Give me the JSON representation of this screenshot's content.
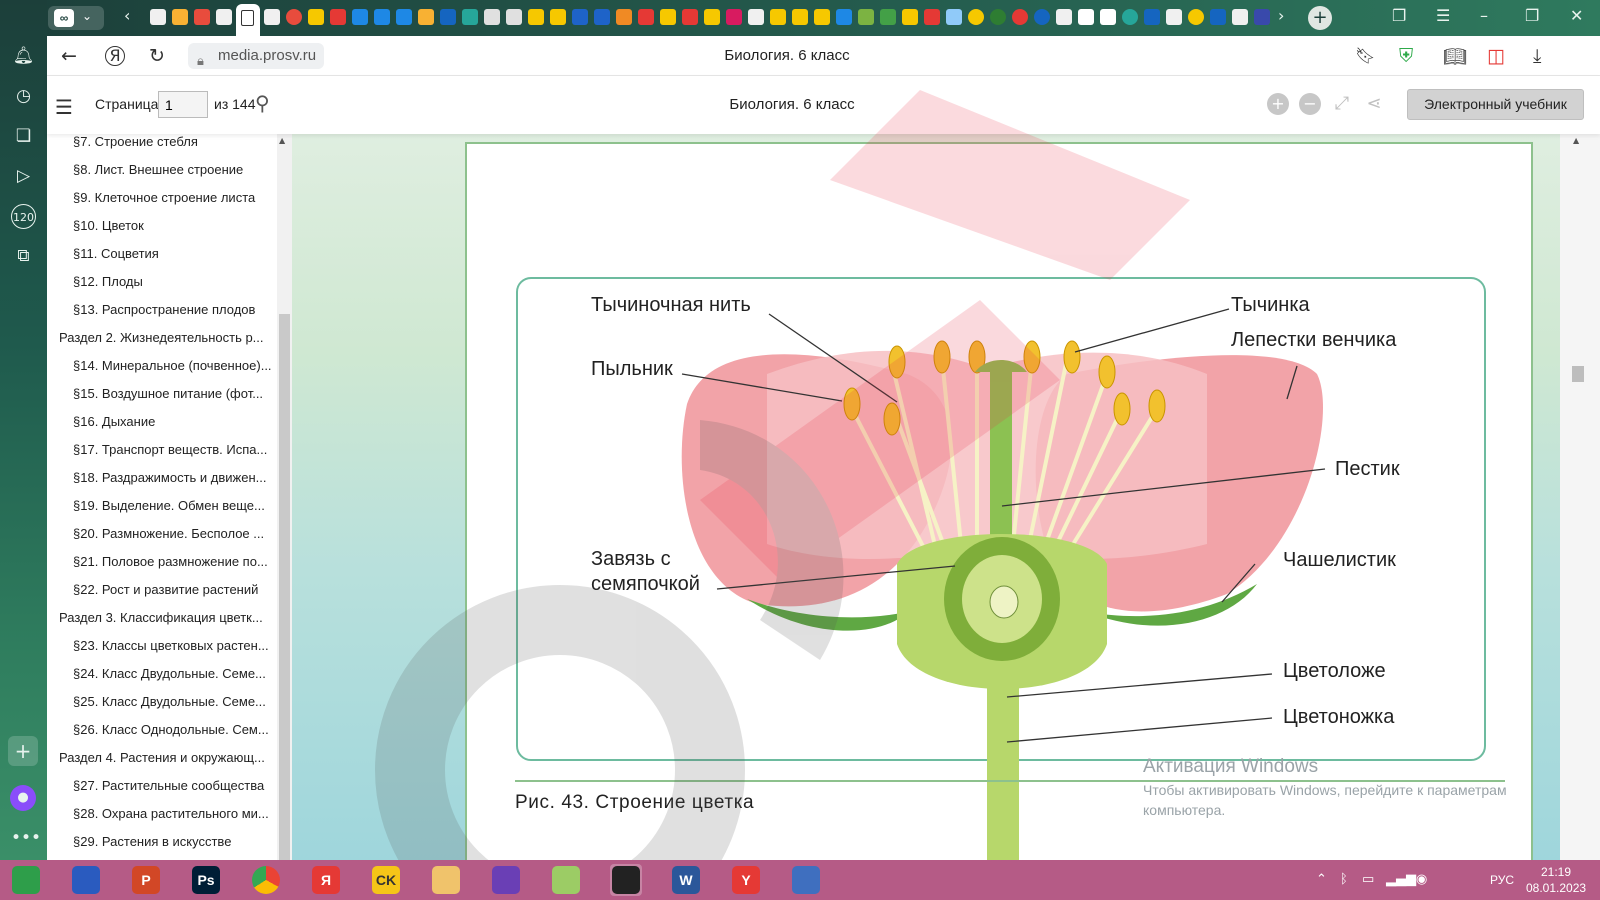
{
  "browser": {
    "active_tab_title": "Биология. 6 класс",
    "url": "media.prosv.ru",
    "tab_controls": {
      "back": "‹",
      "forward": "›",
      "new_tab": "+"
    },
    "window_controls": [
      "tabs-icon",
      "menu-icon",
      "minimize-icon",
      "restore-icon",
      "close-icon"
    ],
    "accent_color": "#1f5a4d"
  },
  "reader": {
    "page_label": "Страница",
    "page_value": "1",
    "page_total": "из 144",
    "title": "Биология. 6 класс",
    "ebook_button": "Электронный учебник"
  },
  "toc": {
    "items": [
      {
        "label": "§7. Строение стебля",
        "level": 2
      },
      {
        "label": "§8. Лист. Внешнее строение",
        "level": 2
      },
      {
        "label": "§9. Клеточное строение листа",
        "level": 2
      },
      {
        "label": "§10. Цветок",
        "level": 2
      },
      {
        "label": "§11. Соцветия",
        "level": 2
      },
      {
        "label": "§12. Плоды",
        "level": 2
      },
      {
        "label": "§13. Распространение плодов",
        "level": 2
      },
      {
        "label": "Раздел 2. Жизнедеятельность р...",
        "level": 1
      },
      {
        "label": "§14. Минеральное (почвенное)...",
        "level": 2
      },
      {
        "label": "§15. Воздушное питание (фот...",
        "level": 2
      },
      {
        "label": "§16. Дыхание",
        "level": 2
      },
      {
        "label": "§17. Транспорт веществ. Испа...",
        "level": 2
      },
      {
        "label": "§18. Раздражимость и движен...",
        "level": 2
      },
      {
        "label": "§19. Выделение. Обмен веще...",
        "level": 2
      },
      {
        "label": "§20. Размножение. Бесполое ...",
        "level": 2
      },
      {
        "label": "§21. Половое размножение по...",
        "level": 2
      },
      {
        "label": "§22. Рост и развитие растений",
        "level": 2
      },
      {
        "label": "Раздел 3. Классификация цветк...",
        "level": 1
      },
      {
        "label": "§23. Классы цветковых растен...",
        "level": 2
      },
      {
        "label": "§24. Класс Двудольные. Семе...",
        "level": 2
      },
      {
        "label": "§25. Класс Двудольные. Семе...",
        "level": 2
      },
      {
        "label": "§26. Класс Однодольные. Сем...",
        "level": 2
      },
      {
        "label": "Раздел 4. Растения и окружающ...",
        "level": 1
      },
      {
        "label": "§27. Растительные сообщества",
        "level": 2
      },
      {
        "label": "§28. Охрана растительного ми...",
        "level": 2
      },
      {
        "label": "§29. Растения в искусстве",
        "level": 2
      }
    ]
  },
  "figure": {
    "labels": {
      "filament": "Тычиночная нить",
      "anther": "Пыльник",
      "stamen": "Тычинка",
      "petals": "Лепестки венчика",
      "pistil": "Пестик",
      "ovary_line1": "Завязь с",
      "ovary_line2": "семяпочкой",
      "sepal": "Чашелистик",
      "receptacle": "Цветоложе",
      "pedicel": "Цветоножка"
    },
    "caption": "Рис. 43. Строение цветка",
    "colors": {
      "petal": "#f2a3a8",
      "stem": "#9ccc65",
      "anther": "#f2c12e",
      "frame": "#6dbb9f"
    }
  },
  "windows_activation": {
    "title": "Активация Windows",
    "text": "Чтобы активировать Windows, перейдите к параметрам компьютера."
  },
  "taskbar": {
    "apps": [
      {
        "name": "clover-app",
        "label": ""
      },
      {
        "name": "archive-app",
        "label": ""
      },
      {
        "name": "powerpoint-app",
        "label": "P"
      },
      {
        "name": "photoshop-app",
        "label": "Ps"
      },
      {
        "name": "chrome-app",
        "label": ""
      },
      {
        "name": "yandex-browser-app",
        "label": "Я"
      },
      {
        "name": "ck-app",
        "label": "CK"
      },
      {
        "name": "explorer-app",
        "label": ""
      },
      {
        "name": "visual-studio-app",
        "label": ""
      },
      {
        "name": "paint-app",
        "label": ""
      },
      {
        "name": "inkscape-app",
        "label": ""
      },
      {
        "name": "word-app",
        "label": "W"
      },
      {
        "name": "yandex-app",
        "label": "Y"
      },
      {
        "name": "remote-app",
        "label": ""
      }
    ],
    "language": "РУС",
    "time": "21:19",
    "date": "08.01.2023"
  }
}
